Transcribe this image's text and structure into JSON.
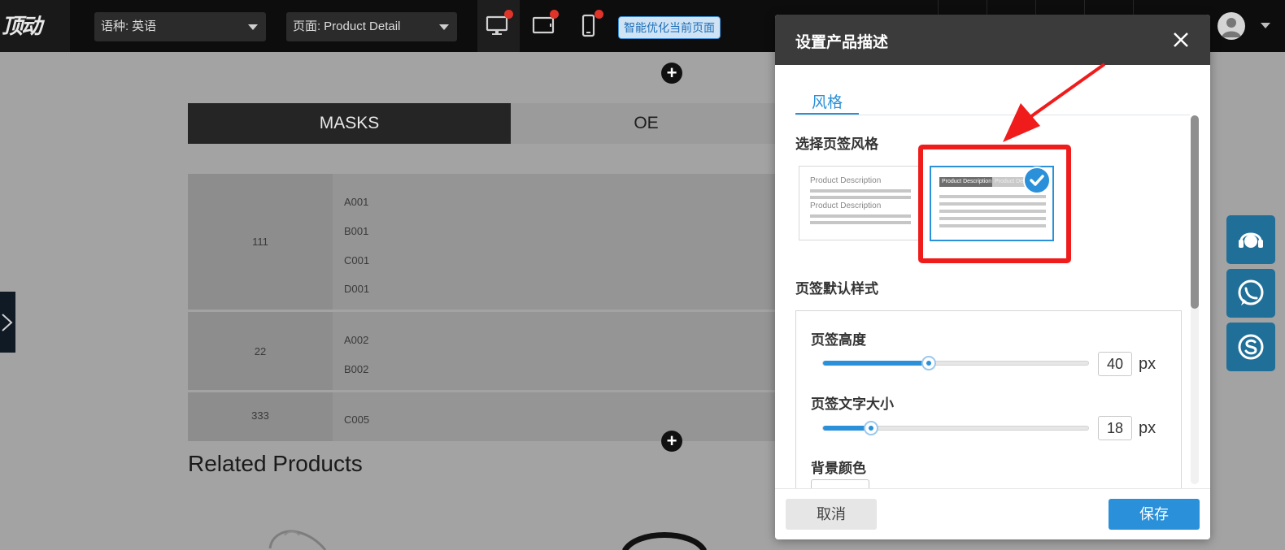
{
  "topbar": {
    "logo_text": "顶动",
    "language": {
      "label": "语种:",
      "value": "英语"
    },
    "page": {
      "label": "页面:",
      "value": "Product Detail"
    },
    "optimize_button": "智能优化当前页面"
  },
  "canvas": {
    "tabs": [
      "MASKS",
      "OE"
    ],
    "table": [
      {
        "num": "111",
        "codes": [
          "A001",
          "B001",
          "C001",
          "D001"
        ]
      },
      {
        "num": "22",
        "codes": [
          "A002",
          "B002"
        ]
      },
      {
        "num": "333",
        "codes": [
          "C005"
        ]
      }
    ],
    "related_heading": "Related Products"
  },
  "dialog": {
    "title": "设置产品描述",
    "tab": "风格",
    "section_style": "选择页签风格",
    "card1_labels": [
      "Product Description",
      "Product Description"
    ],
    "card2_labels": [
      "Product Description",
      "Product Desc"
    ],
    "section_default": "页签默认样式",
    "height": {
      "label": "页签高度",
      "value": "40",
      "unit": "px",
      "fraction": 0.4
    },
    "font_size": {
      "label": "页签文字大小",
      "value": "18",
      "unit": "px",
      "fraction": 0.18
    },
    "bg_color_label": "背景颜色",
    "cancel": "取消",
    "save": "保存"
  },
  "colors": {
    "accent": "#2a90d9",
    "highlight": "#f01c1c",
    "topbar": "#0d0d0d",
    "dialog_header": "#3b3b3b",
    "social": "#1f6f99"
  },
  "icons": [
    "desktop-icon",
    "tablet-icon",
    "mobile-icon",
    "user-avatar-icon",
    "close-icon",
    "check-icon",
    "customer-service-icon",
    "whatsapp-icon",
    "skype-icon",
    "plus-icon",
    "chevron-right-icon"
  ]
}
